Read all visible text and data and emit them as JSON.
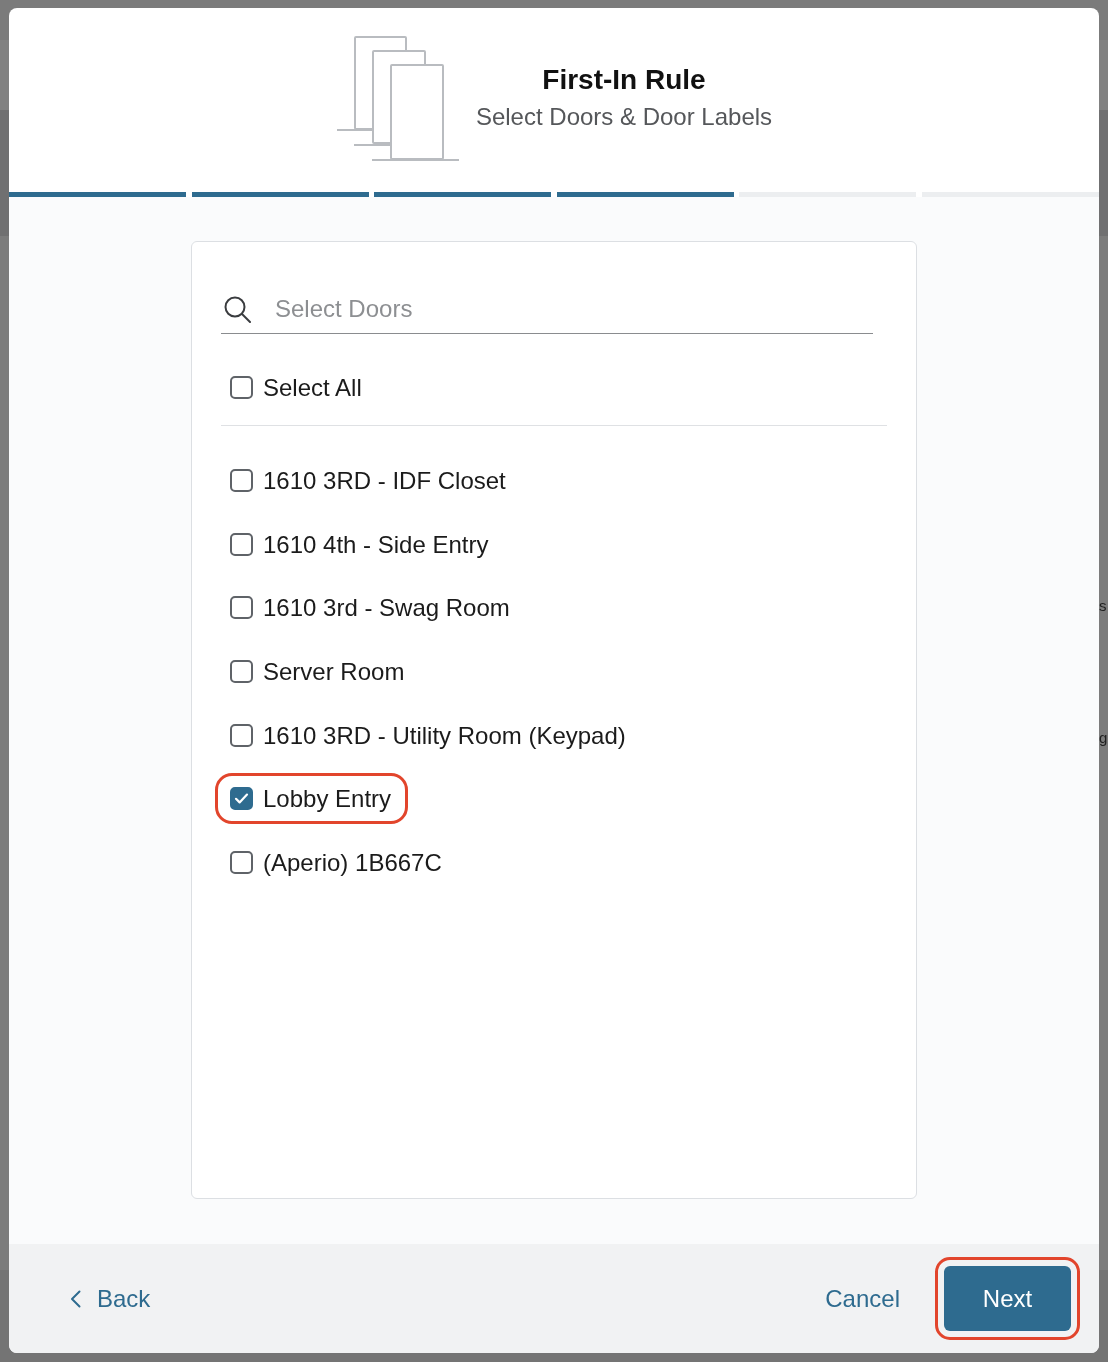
{
  "dialog": {
    "title": "First-In Rule",
    "subtitle": "Select Doors & Door Labels"
  },
  "steps": [
    {
      "complete": true
    },
    {
      "complete": true
    },
    {
      "complete": true
    },
    {
      "complete": true
    },
    {
      "complete": false
    },
    {
      "complete": false
    }
  ],
  "search": {
    "placeholder": "Select Doors"
  },
  "select_all": {
    "label": "Select All",
    "checked": false
  },
  "doors": [
    {
      "label": "1610 3RD - IDF Closet",
      "checked": false,
      "highlighted": false
    },
    {
      "label": "1610 4th - Side Entry",
      "checked": false,
      "highlighted": false
    },
    {
      "label": "1610 3rd - Swag Room",
      "checked": false,
      "highlighted": false
    },
    {
      "label": "Server Room",
      "checked": false,
      "highlighted": false
    },
    {
      "label": "1610 3RD - Utility Room (Keypad)",
      "checked": false,
      "highlighted": false
    },
    {
      "label": "Lobby Entry",
      "checked": true,
      "highlighted": true
    },
    {
      "label": "(Aperio) 1B667C",
      "checked": false,
      "highlighted": false
    }
  ],
  "footer": {
    "back": "Back",
    "cancel": "Cancel",
    "next": {
      "label": "Next",
      "highlighted": true
    }
  },
  "background": {
    "texts": [
      "s",
      "g"
    ]
  }
}
